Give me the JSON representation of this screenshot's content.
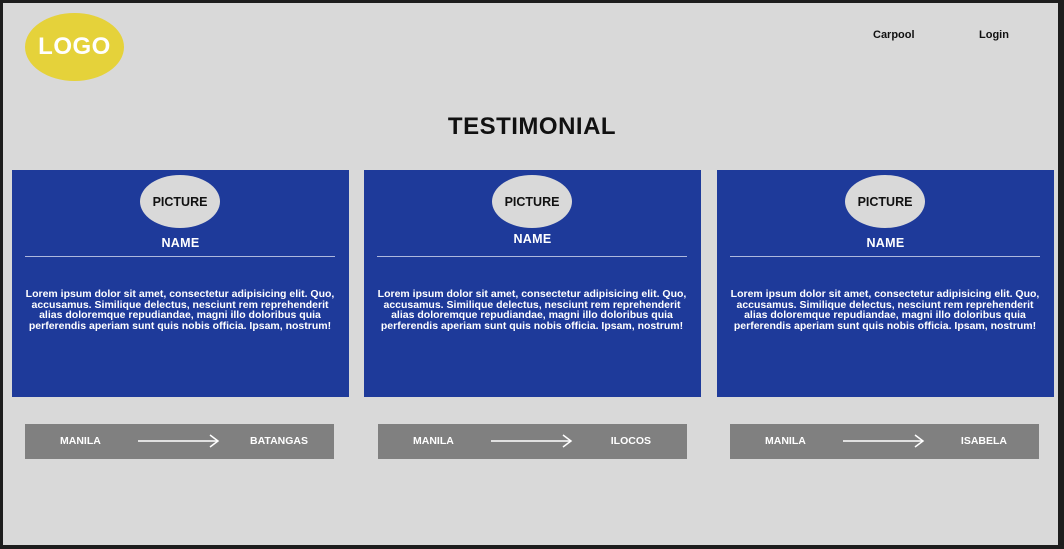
{
  "header": {
    "logo_text": "LOGO",
    "nav": [
      {
        "label": "Carpool"
      },
      {
        "label": "Login"
      }
    ]
  },
  "page_title": "TESTIMONIAL",
  "testimonials": [
    {
      "picture": "PICTURE",
      "name": "NAME",
      "text": "Lorem ipsum dolor sit amet, consectetur adipisicing elit. Quo, accusamus. Similique delectus, nesciunt rem reprehenderit alias doloremque repudiandae, magni illo doloribus quia perferendis aperiam sunt quis nobis officia. Ipsam, nostrum!",
      "route_from": "MANILA",
      "route_to": "BATANGAS"
    },
    {
      "picture": "PICTURE",
      "name": "NAME",
      "text": "Lorem ipsum dolor sit amet, consectetur adipisicing elit. Quo, accusamus. Similique delectus, nesciunt rem reprehenderit alias doloremque repudiandae, magni illo doloribus quia perferendis aperiam sunt quis nobis officia. Ipsam, nostrum!",
      "route_from": "MANILA",
      "route_to": "ILOCOS"
    },
    {
      "picture": "PICTURE",
      "name": "NAME",
      "text": "Lorem ipsum dolor sit amet, consectetur adipisicing elit. Quo, accusamus. Similique delectus, nesciunt rem reprehenderit alias doloremque repudiandae, magni illo doloribus quia perferendis aperiam sunt quis nobis officia. Ipsam, nostrum!",
      "route_from": "MANILA",
      "route_to": "ISABELA"
    }
  ],
  "colors": {
    "background": "#d9d9d9",
    "logo": "#e5d23a",
    "card": "#1e3a9a",
    "route_bar": "#808080"
  },
  "icons": {
    "route_arrow": "arrow-right-icon"
  }
}
